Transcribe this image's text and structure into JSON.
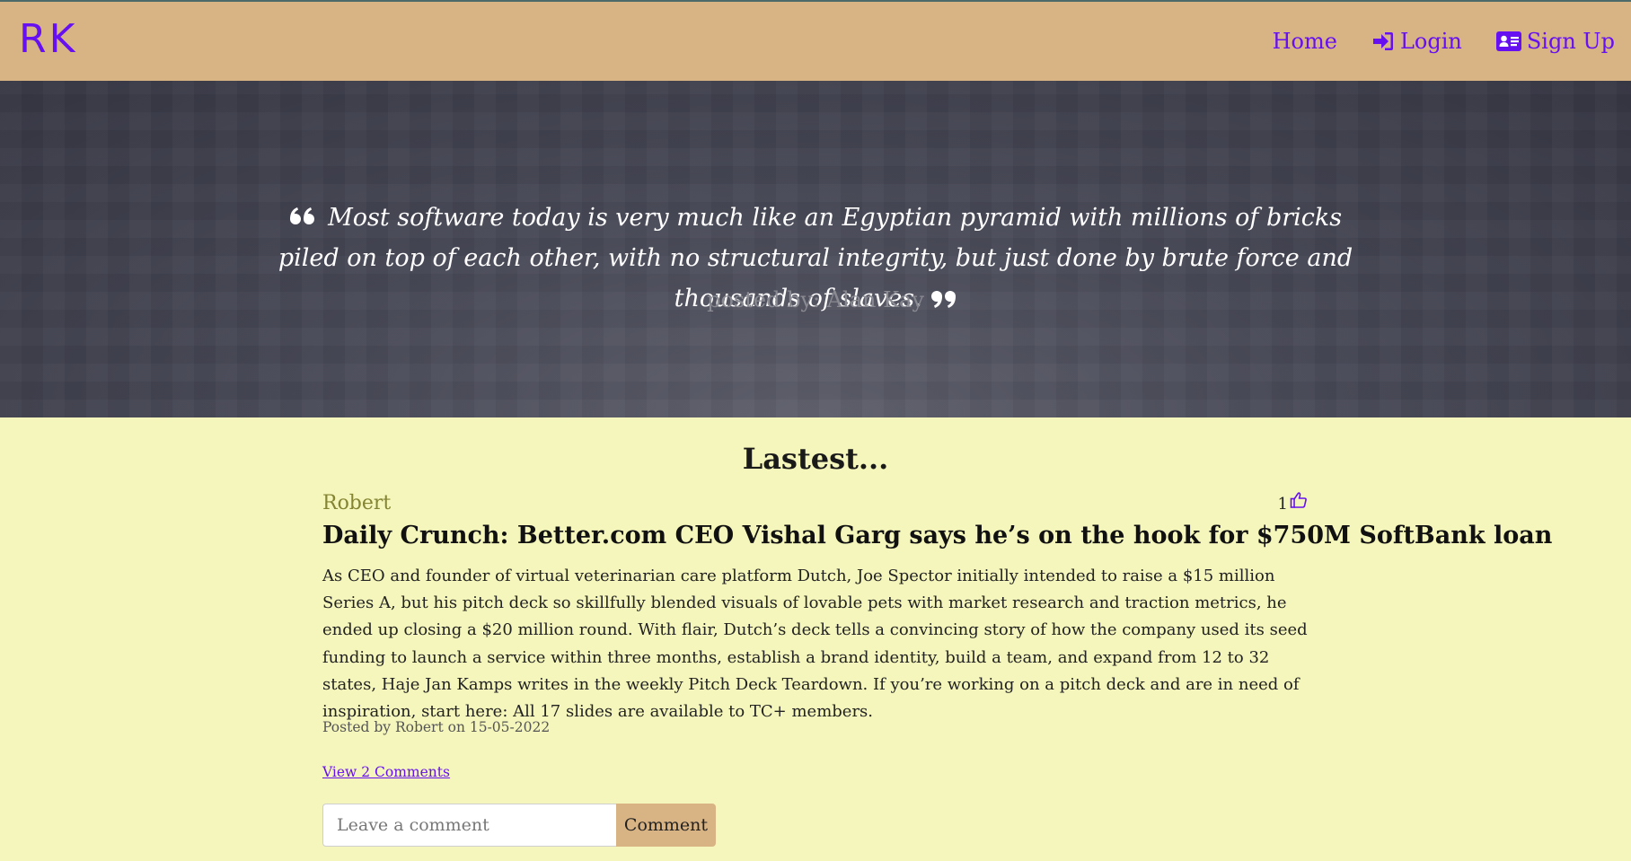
{
  "navbar": {
    "brand": "RK",
    "links": [
      {
        "label": "Home",
        "icon": ""
      },
      {
        "label": "Login",
        "icon": "sign-in-icon"
      },
      {
        "label": "Sign Up",
        "icon": "id-card-icon"
      }
    ],
    "accent_color": "#6610f2",
    "background_color": "#d8b383"
  },
  "hero": {
    "quote": "Most software today is very much like an Egyptian pyramid with millions of bricks piled on top of each other, with no structural integrity, but just done by brute force and thousands of slaves.",
    "open_quote_icon": "quote-left-icon",
    "close_quote_icon": "quote-right-icon",
    "posted_by": "posted by: Alan Kay"
  },
  "main": {
    "section_title": "Lastest...",
    "background_color": "#f5f6bb",
    "post": {
      "author": "Robert",
      "likes": "1",
      "like_icon": "thumbs-up-icon",
      "title": "Daily Crunch: Better.com CEO Vishal Garg says he’s on the hook for $750M SoftBank loan",
      "body": "As CEO and founder of virtual veterinarian care platform Dutch, Joe Spector initially intended to raise a $15 million Series A, but his pitch deck so skillfully blended visuals of lovable pets with market research and traction metrics, he ended up closing a $20 million round. With flair, Dutch’s deck tells a convincing story of how the company used its seed funding to launch a service within three months, establish a brand identity, build a team, and expand from 12 to 32 states, Haje Jan Kamps writes in the weekly Pitch Deck Teardown. If you’re working on a pitch deck and are in need of inspiration, start here: All 17 slides are available to TC+ members.",
      "meta": "Posted by Robert on 15-05-2022",
      "view_comments": "View 2 Comments",
      "comment_placeholder": "Leave a comment",
      "comment_button": "Comment"
    }
  }
}
